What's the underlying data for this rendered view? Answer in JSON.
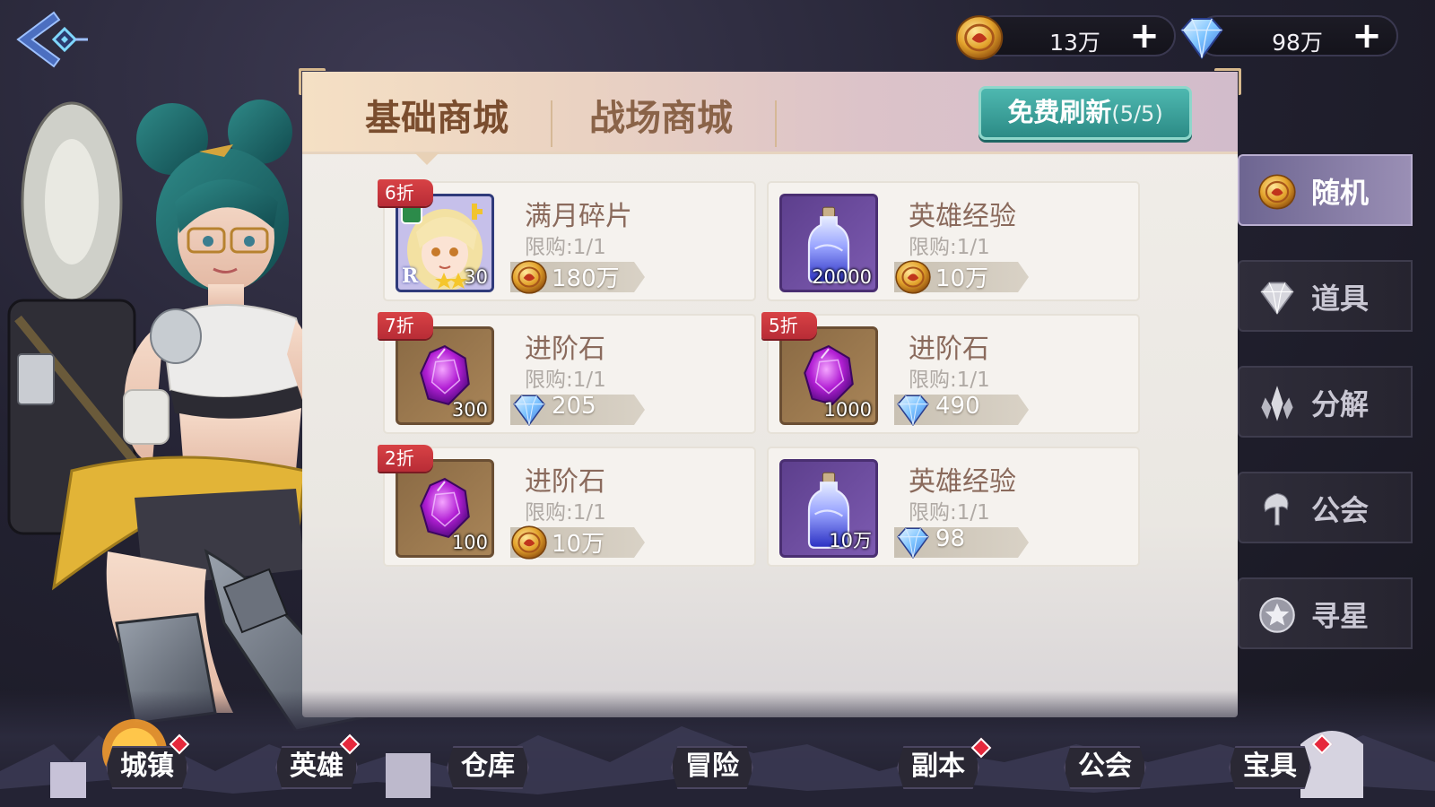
{
  "header": {
    "gold": {
      "icon": "gold-coin-icon",
      "amount": "13万"
    },
    "gems": {
      "icon": "diamond-icon",
      "amount": "98万"
    }
  },
  "shop": {
    "tabs": [
      {
        "label": "基础商城",
        "active": true
      },
      {
        "label": "战场商城",
        "active": false
      }
    ],
    "refresh_label": "免费刷新",
    "refresh_count": "(5/5)",
    "items": [
      {
        "discount": "6折",
        "name": "满月碎片",
        "limit": "限购:1/1",
        "price": "180万",
        "currency": "gold-coin-icon",
        "qty": "30",
        "icon": "hero-portrait-icon",
        "hero_rank": "R"
      },
      {
        "discount": "",
        "name": "英雄经验",
        "limit": "限购:1/1",
        "price": "10万",
        "currency": "gold-coin-icon",
        "qty": "20000",
        "icon": "exp-potion-icon"
      },
      {
        "discount": "7折",
        "name": "进阶石",
        "limit": "限购:1/1",
        "price": "205",
        "currency": "diamond-icon",
        "qty": "300",
        "icon": "purple-gem-icon"
      },
      {
        "discount": "5折",
        "name": "进阶石",
        "limit": "限购:1/1",
        "price": "490",
        "currency": "diamond-icon",
        "qty": "1000",
        "icon": "purple-gem-icon"
      },
      {
        "discount": "2折",
        "name": "进阶石",
        "limit": "限购:1/1",
        "price": "10万",
        "currency": "gold-coin-icon",
        "qty": "100",
        "icon": "purple-gem-icon"
      },
      {
        "discount": "",
        "name": "英雄经验",
        "limit": "限购:1/1",
        "price": "98",
        "currency": "diamond-icon",
        "qty": "10万",
        "icon": "exp-potion-icon"
      }
    ]
  },
  "side_menu": [
    {
      "label": "随机",
      "icon": "gold-coin-icon",
      "active": true
    },
    {
      "label": "道具",
      "icon": "diamond-icon",
      "active": false
    },
    {
      "label": "分解",
      "icon": "crystal-shard-icon",
      "active": false
    },
    {
      "label": "公会",
      "icon": "guild-crest-icon",
      "active": false
    },
    {
      "label": "寻星",
      "icon": "star-medal-icon",
      "active": false
    }
  ],
  "bottom_nav": [
    {
      "label": "城镇",
      "badge": true
    },
    {
      "label": "英雄",
      "badge": true
    },
    {
      "label": "仓库",
      "badge": false
    },
    {
      "label": "冒险",
      "badge": false
    },
    {
      "label": "副本",
      "badge": true
    },
    {
      "label": "公会",
      "badge": false
    },
    {
      "label": "宝具",
      "badge": true
    }
  ],
  "colors": {
    "accent_teal": "#2c8b86",
    "discount_red": "#c8343d",
    "active_tab": "#7a4d2e"
  }
}
